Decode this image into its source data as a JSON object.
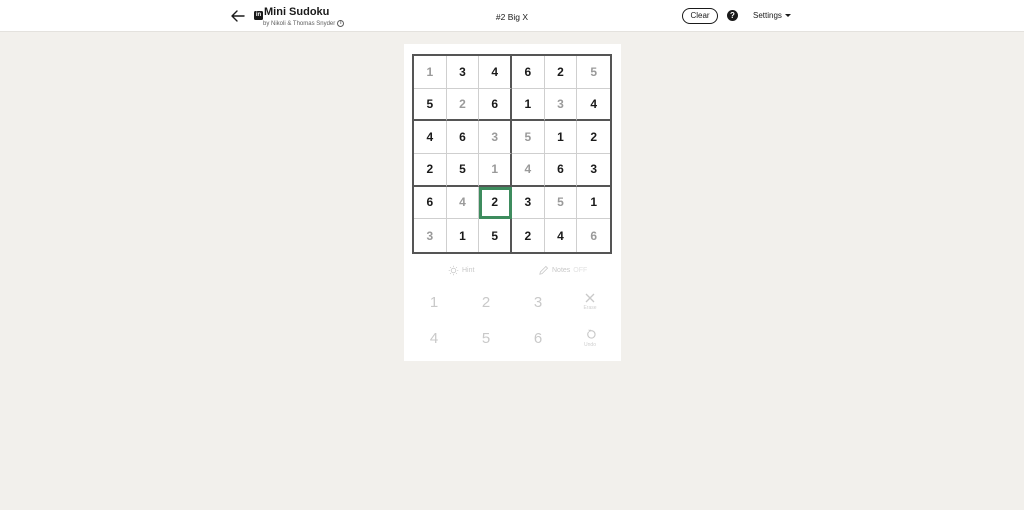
{
  "header": {
    "back_icon": "arrow-left-icon",
    "brand_badge": "in",
    "app_title": "Mini Sudoku",
    "byline": "by Nikoli & Thomas Snyder",
    "puzzle_name": "#2 Big X",
    "clear_label": "Clear",
    "help_icon": "?",
    "settings_label": "Settings"
  },
  "board": {
    "selected_cell": {
      "row": 4,
      "col": 2
    },
    "rows": [
      [
        {
          "v": "1",
          "given": false
        },
        {
          "v": "3",
          "given": true
        },
        {
          "v": "4",
          "given": true
        },
        {
          "v": "6",
          "given": true
        },
        {
          "v": "2",
          "given": true
        },
        {
          "v": "5",
          "given": false
        }
      ],
      [
        {
          "v": "5",
          "given": true
        },
        {
          "v": "2",
          "given": false
        },
        {
          "v": "6",
          "given": true
        },
        {
          "v": "1",
          "given": true
        },
        {
          "v": "3",
          "given": false
        },
        {
          "v": "4",
          "given": true
        }
      ],
      [
        {
          "v": "4",
          "given": true
        },
        {
          "v": "6",
          "given": true
        },
        {
          "v": "3",
          "given": false
        },
        {
          "v": "5",
          "given": false
        },
        {
          "v": "1",
          "given": true
        },
        {
          "v": "2",
          "given": true
        }
      ],
      [
        {
          "v": "2",
          "given": true
        },
        {
          "v": "5",
          "given": true
        },
        {
          "v": "1",
          "given": false
        },
        {
          "v": "4",
          "given": false
        },
        {
          "v": "6",
          "given": true
        },
        {
          "v": "3",
          "given": true
        }
      ],
      [
        {
          "v": "6",
          "given": true
        },
        {
          "v": "4",
          "given": false
        },
        {
          "v": "2",
          "given": false
        },
        {
          "v": "3",
          "given": true
        },
        {
          "v": "5",
          "given": false
        },
        {
          "v": "1",
          "given": true
        }
      ],
      [
        {
          "v": "3",
          "given": false
        },
        {
          "v": "1",
          "given": true
        },
        {
          "v": "5",
          "given": true
        },
        {
          "v": "2",
          "given": true
        },
        {
          "v": "4",
          "given": true
        },
        {
          "v": "6",
          "given": false
        }
      ]
    ]
  },
  "tools": {
    "hint_label": "Hint",
    "notes_label": "Notes",
    "notes_state": "OFF"
  },
  "keypad": {
    "digits": [
      "1",
      "2",
      "3",
      "4",
      "5",
      "6"
    ],
    "erase_label": "Erase",
    "undo_label": "Undo"
  },
  "colors": {
    "selected_border": "#3e8c5e",
    "background": "#f2f0ec",
    "panel": "#ffffff"
  }
}
